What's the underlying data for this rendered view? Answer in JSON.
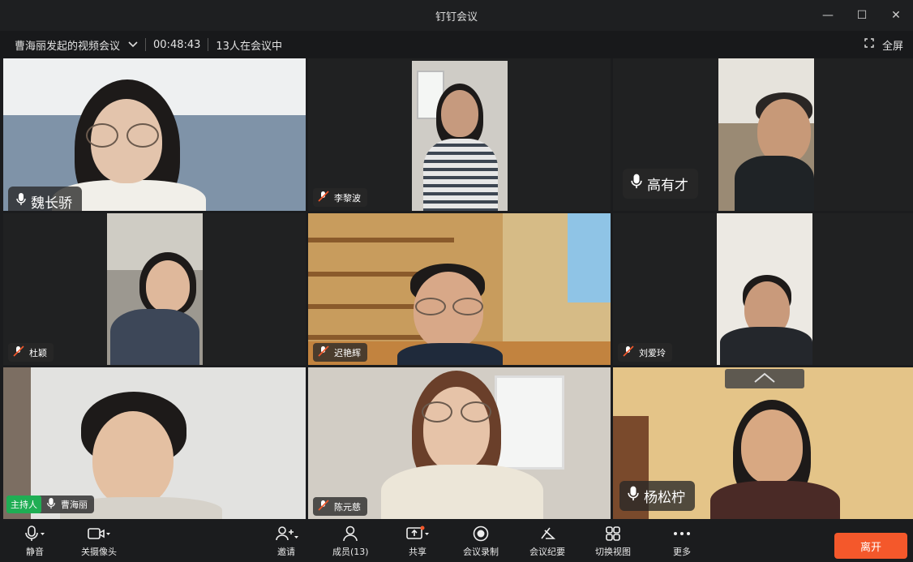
{
  "app": {
    "title": "钉钉会议"
  },
  "window_controls": {
    "minimize": "—",
    "maximize": "☐",
    "close": "✕"
  },
  "meeting": {
    "title": "曹海丽发起的视频会议",
    "elapsed": "00:48:43",
    "participants": "13人在会议中",
    "fullscreen_label": "全屏"
  },
  "tiles": [
    {
      "name": "魏长骄",
      "mic": "on",
      "tag_size": "big",
      "bg": "#c9ced3"
    },
    {
      "name": "李黎波",
      "mic": "muted",
      "tag_size": "small",
      "bg": "#b7b4ae"
    },
    {
      "name": "高有才",
      "mic": "on",
      "tag_size": "big",
      "bg": "#8a7a68"
    },
    {
      "name": "杜颖",
      "mic": "muted",
      "tag_size": "small",
      "bg": "#a4a19a"
    },
    {
      "name": "迟艳辉",
      "mic": "muted",
      "tag_size": "small",
      "bg": "#d8b981"
    },
    {
      "name": "刘爱玲",
      "mic": "muted",
      "tag_size": "small",
      "bg": "#e8e6e2"
    },
    {
      "name": "曹海丽",
      "mic": "on",
      "tag_size": "small",
      "host": "主持人",
      "bg": "#dcdcdc"
    },
    {
      "name": "陈元慈",
      "mic": "muted",
      "tag_size": "small",
      "bg": "#cfcac1"
    },
    {
      "name": "杨松柠",
      "mic": "on",
      "tag_size": "big",
      "bg": "#e4c488"
    }
  ],
  "toolbar": {
    "mute": "静音",
    "camera_off": "关摄像头",
    "invite": "邀请",
    "members": "成员(13)",
    "share": "共享",
    "record": "会议录制",
    "summary": "会议纪要",
    "switch_view": "切换视图",
    "more": "更多",
    "leave": "离开"
  },
  "colors": {
    "leave": "#f4582b",
    "host_badge": "#1fae54"
  }
}
